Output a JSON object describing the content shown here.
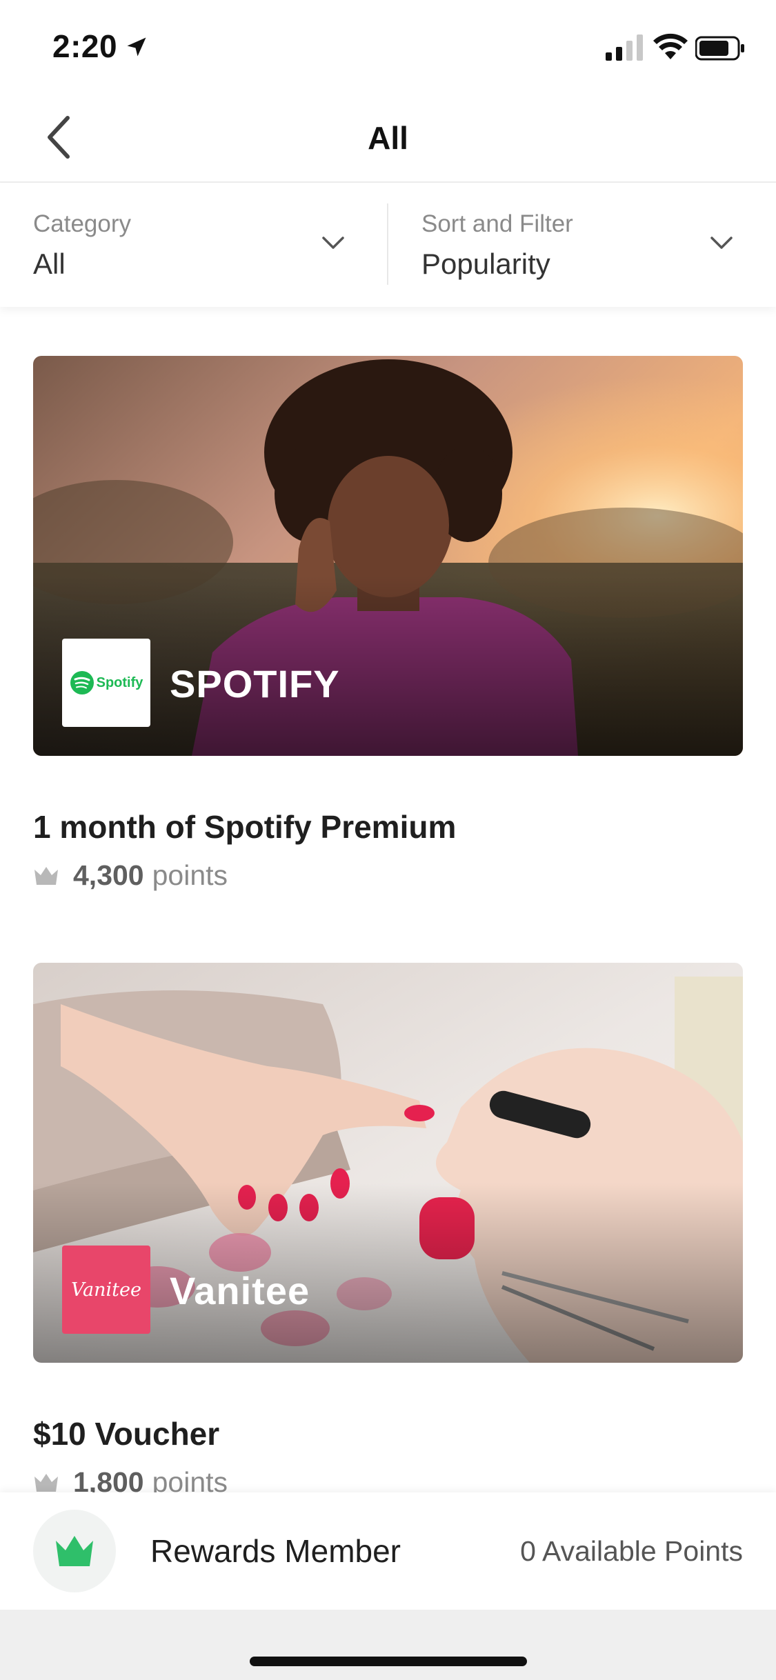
{
  "status_bar": {
    "time": "2:20"
  },
  "nav": {
    "title": "All"
  },
  "filters": {
    "category": {
      "label": "Category",
      "value": "All"
    },
    "sort": {
      "label": "Sort and Filter",
      "value": "Popularity"
    }
  },
  "rewards": [
    {
      "brand": "SPOTIFY",
      "logo_text": "Spotify",
      "title": "1 month of Spotify Premium",
      "points": "4,300",
      "points_unit": "points"
    },
    {
      "brand": "Vanitee",
      "logo_text": "Vanitee",
      "title": "$10 Voucher",
      "points": "1,800",
      "points_unit": "points"
    }
  ],
  "footer": {
    "member_label": "Rewards Member",
    "available_points": "0 Available Points"
  },
  "colors": {
    "accent_green": "#2fbf6a",
    "spotify_green": "#1db954",
    "vanitee_pink": "#e8466a"
  },
  "icons": [
    "location-arrow-icon",
    "cellular-signal-icon",
    "wifi-icon",
    "battery-icon",
    "back-chevron-icon",
    "chevron-down-icon",
    "crown-icon"
  ]
}
